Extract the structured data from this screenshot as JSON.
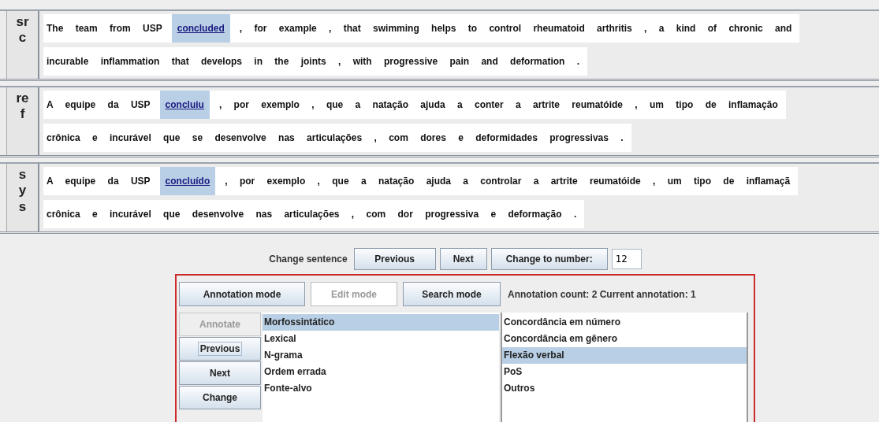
{
  "panels": [
    {
      "label": "src",
      "lines": [
        [
          {
            "text": "The team from USP",
            "selected": false
          },
          {
            "text": "concluded",
            "selected": true
          },
          {
            "text": ", for example , that swimming helps to control rheumatoid arthritis , a kind of chronic and",
            "selected": false
          }
        ],
        [
          {
            "text": "incurable inflammation that develops in the joints , with progressive pain and deformation .",
            "selected": false
          }
        ]
      ]
    },
    {
      "label": "ref",
      "lines": [
        [
          {
            "text": "A equipe da USP",
            "selected": false
          },
          {
            "text": "concluiu",
            "selected": true
          },
          {
            "text": ", por exemplo , que a natação ajuda a conter a artrite reumatóide , um tipo de inflamação",
            "selected": false
          }
        ],
        [
          {
            "text": "crônica e incurável que se desenvolve nas articulações , com dores e deformidades progressivas .",
            "selected": false
          }
        ]
      ]
    },
    {
      "label": "sys",
      "lines": [
        [
          {
            "text": "A equipe da USP",
            "selected": false
          },
          {
            "text": "concluído",
            "selected": true
          },
          {
            "text": ", por exemplo , que a natação ajuda a controlar a artrite reumatóide , um tipo de inflamaçã",
            "selected": false
          }
        ],
        [
          {
            "text": "crônica e incurável que desenvolve nas articulações , com dor progressiva e deformação .",
            "selected": false
          }
        ]
      ]
    }
  ],
  "navigation": {
    "label": "Change sentence",
    "buttons": [
      "Previous",
      "Next",
      "Change to number:"
    ],
    "number_field": "12"
  },
  "annotation": {
    "modes": [
      {
        "label": "Annotation mode",
        "disabled": false
      },
      {
        "label": "Edit mode",
        "disabled": true
      },
      {
        "label": "Search mode",
        "disabled": false
      }
    ],
    "status": "Annotation count: 2 Current annotation: 1",
    "actions": [
      {
        "label": "Annotate",
        "disabled": true,
        "focused": false
      },
      {
        "label": "Previous",
        "disabled": false,
        "focused": true
      },
      {
        "label": "Next",
        "disabled": false,
        "focused": false
      },
      {
        "label": "Change",
        "disabled": false,
        "focused": false
      }
    ],
    "categories": [
      {
        "label": "Morfossintático",
        "selected": true
      },
      {
        "label": "Lexical",
        "selected": false
      },
      {
        "label": "N-grama",
        "selected": false
      },
      {
        "label": "Ordem errada",
        "selected": false
      },
      {
        "label": "Fonte-alvo",
        "selected": false
      }
    ],
    "subcategories": [
      {
        "label": "Concordância em número",
        "selected": false
      },
      {
        "label": "Concordância em gênero",
        "selected": false
      },
      {
        "label": "Flexão verbal",
        "selected": true
      },
      {
        "label": "PoS",
        "selected": false
      },
      {
        "label": "Outros",
        "selected": false
      }
    ]
  }
}
